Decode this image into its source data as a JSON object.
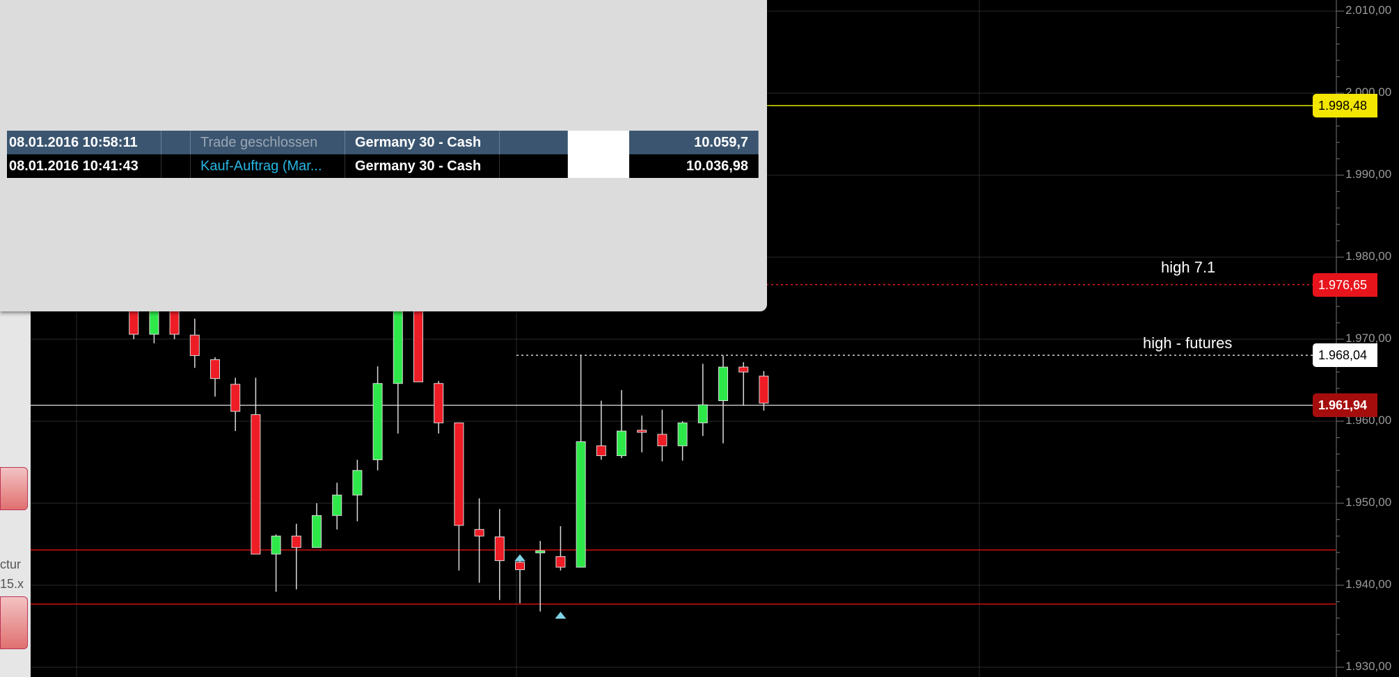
{
  "colors": {
    "bull": "#2ee84a",
    "bear": "#ee1c25",
    "grid": "#2a2a2a",
    "current": "#c00000",
    "yellow_line": "#e8e800"
  },
  "trades_popup": {
    "rows": [
      {
        "time": "08.01.2016 10:58:11",
        "type": "Trade geschlossen",
        "instrument": "Germany 30 - Cash",
        "value": "10.059,7",
        "type_color": "#9aa6b3"
      },
      {
        "time": "08.01.2016 10:41:43",
        "type": "Kauf-Auftrag (Mar...",
        "instrument": "Germany 30 - Cash",
        "value": "10.036,98",
        "type_color": "#27b7e6"
      }
    ]
  },
  "background_window": {
    "text_line1": "ctur",
    "text_line2": "15.x"
  },
  "chart_data": {
    "type": "candlestick",
    "ylim": [
      1928.4,
      2012.0
    ],
    "y_ticks": [
      "2.010,00",
      "2.000,00",
      "1.990,00",
      "1.980,00",
      "1.970,00",
      "1.960,00",
      "1.950,00",
      "1.940,00",
      "1.930,00"
    ],
    "y_tick_values": [
      2010,
      2000,
      1990,
      1980,
      1970,
      1960,
      1950,
      1940,
      1930
    ],
    "price_tags": [
      {
        "label": "1.998,48",
        "value": 1998.48,
        "style": "yellow"
      },
      {
        "label": "1.976,65",
        "value": 1976.65,
        "style": "red"
      },
      {
        "label": "1.968,04",
        "value": 1968.04,
        "style": "white"
      },
      {
        "label": "1.961,94",
        "value": 1961.94,
        "style": "current"
      }
    ],
    "horizontal_lines": [
      {
        "value": 1998.48,
        "color": "#e8e800",
        "dash": ""
      },
      {
        "value": 1976.65,
        "color": "#ee1c25",
        "dash": "3,4"
      },
      {
        "value": 1961.94,
        "color": "#bdbdbd",
        "dash": ""
      },
      {
        "value": 1944.3,
        "color": "#d01010",
        "dash": ""
      },
      {
        "value": 1937.7,
        "color": "#d01010",
        "dash": ""
      }
    ],
    "annotations": [
      {
        "text": "high 7.1",
        "value": 1976.65
      },
      {
        "text": "high - futures",
        "value": 1968.04
      }
    ],
    "candles": [
      {
        "open": 1975.0,
        "high": 1976.0,
        "low": 1973.5,
        "close": 1973.8
      },
      {
        "open": 1973.8,
        "high": 1974.5,
        "low": 1970.0,
        "close": 1970.6
      },
      {
        "open": 1970.6,
        "high": 1974.5,
        "low": 1969.5,
        "close": 1974.0
      },
      {
        "open": 1974.0,
        "high": 1974.8,
        "low": 1970.0,
        "close": 1970.6
      },
      {
        "open": 1970.5,
        "high": 1972.5,
        "low": 1966.5,
        "close": 1968.0
      },
      {
        "open": 1967.5,
        "high": 1967.8,
        "low": 1963.0,
        "close": 1965.2
      },
      {
        "open": 1964.5,
        "high": 1965.3,
        "low": 1958.8,
        "close": 1961.2
      },
      {
        "open": 1960.8,
        "high": 1965.3,
        "low": 1955.0,
        "close": 1943.8
      },
      {
        "open": 1943.8,
        "high": 1946.2,
        "low": 1939.2,
        "close": 1946.0
      },
      {
        "open": 1946.0,
        "high": 1947.5,
        "low": 1939.5,
        "close": 1944.6
      },
      {
        "open": 1944.6,
        "high": 1950.0,
        "low": 1944.6,
        "close": 1948.5
      },
      {
        "open": 1948.5,
        "high": 1952.5,
        "low": 1946.8,
        "close": 1951.0
      },
      {
        "open": 1951.0,
        "high": 1955.3,
        "low": 1947.8,
        "close": 1954.0
      },
      {
        "open": 1955.3,
        "high": 1966.7,
        "low": 1954.0,
        "close": 1964.6
      },
      {
        "open": 1964.6,
        "high": 1990.0,
        "low": 1958.5,
        "close": 1978.0
      },
      {
        "open": 1978.0,
        "high": 1980.0,
        "low": 1964.8,
        "close": 1964.8
      },
      {
        "open": 1964.6,
        "high": 1964.9,
        "low": 1958.5,
        "close": 1959.8
      },
      {
        "open": 1959.8,
        "high": 1959.8,
        "low": 1941.8,
        "close": 1947.3
      },
      {
        "open": 1946.8,
        "high": 1950.6,
        "low": 1940.3,
        "close": 1946.0
      },
      {
        "open": 1945.9,
        "high": 1949.3,
        "low": 1938.2,
        "close": 1943.0
      },
      {
        "open": 1942.8,
        "high": 1943.5,
        "low": 1937.8,
        "close": 1941.9
      },
      {
        "open": 1944.0,
        "high": 1945.4,
        "low": 1936.8,
        "close": 1944.2
      },
      {
        "open": 1943.5,
        "high": 1947.2,
        "low": 1941.8,
        "close": 1942.2
      },
      {
        "open": 1942.2,
        "high": 1968.0,
        "low": 1942.2,
        "close": 1957.5
      },
      {
        "open": 1957.0,
        "high": 1962.5,
        "low": 1955.3,
        "close": 1955.8
      },
      {
        "open": 1955.8,
        "high": 1963.8,
        "low": 1955.5,
        "close": 1958.8
      },
      {
        "open": 1958.9,
        "high": 1960.7,
        "low": 1956.2,
        "close": 1958.7
      },
      {
        "open": 1958.4,
        "high": 1961.4,
        "low": 1955.1,
        "close": 1957.0
      },
      {
        "open": 1957.0,
        "high": 1960.0,
        "low": 1955.2,
        "close": 1959.8
      },
      {
        "open": 1959.8,
        "high": 1967.0,
        "low": 1958.2,
        "close": 1962.0
      },
      {
        "open": 1962.5,
        "high": 1968.0,
        "low": 1957.3,
        "close": 1966.6
      },
      {
        "open": 1966.6,
        "high": 1967.2,
        "low": 1961.9,
        "close": 1966.0
      },
      {
        "open": 1965.5,
        "high": 1966.1,
        "low": 1961.3,
        "close": 1962.2
      }
    ]
  }
}
